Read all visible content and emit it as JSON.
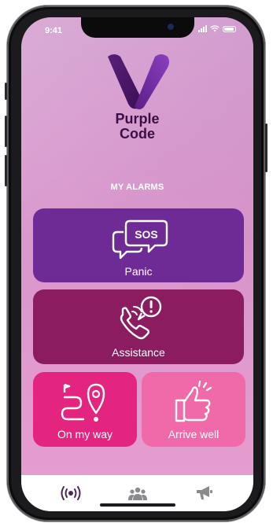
{
  "status_bar": {
    "time": "9:41"
  },
  "brand": {
    "line1": "Purple",
    "line2": "Code"
  },
  "section_title": "MY ALARMS",
  "alarms": {
    "panic": {
      "label": "Panic",
      "icon_text": "SOS"
    },
    "assistance": {
      "label": "Assistance"
    },
    "on_my_way": {
      "label": "On my way"
    },
    "arrive_well": {
      "label": "Arrive well"
    }
  },
  "tabs": [
    {
      "icon": "alarm-broadcast-icon",
      "active": true
    },
    {
      "icon": "group-icon",
      "active": false
    },
    {
      "icon": "megaphone-icon",
      "active": false
    }
  ],
  "colors": {
    "panic": "#6f2b95",
    "assistance": "#8a1c5f",
    "on_my_way": "#e3257f",
    "arrive_well": "#f06aaa",
    "brand_text": "#3a0f46"
  }
}
